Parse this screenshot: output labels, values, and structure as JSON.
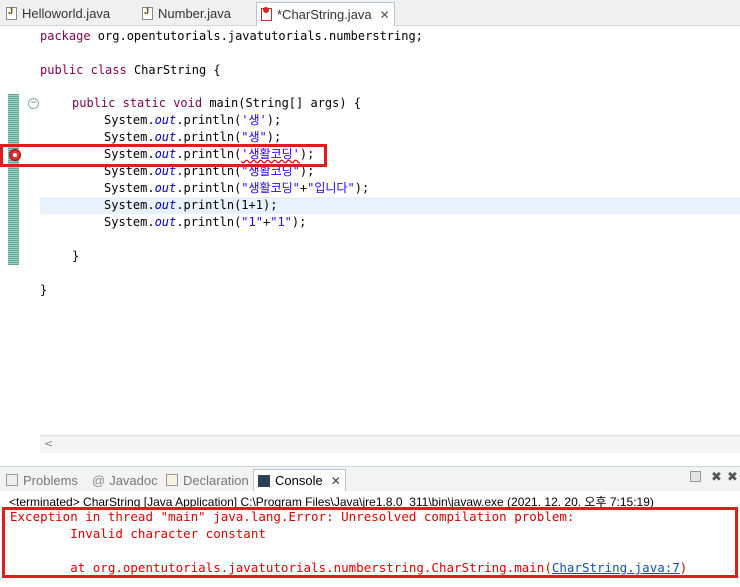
{
  "editor_tabs": [
    {
      "label": "Helloworld.java"
    },
    {
      "label": "Number.java"
    },
    {
      "label": "*CharString.java"
    }
  ],
  "code": {
    "line1": {
      "kw": "package",
      "rest": " org.opentutorials.javatutorials.numberstring;"
    },
    "line2": {
      "kw1": "public",
      "kw2": "class",
      "rest": " CharString {"
    },
    "main": {
      "kw1": "public",
      "kw2": "static",
      "kw3": "void",
      "rest": " main(String[] args) {"
    },
    "prefix": "System.",
    "out": "out",
    "println": ".println(",
    "end": ");",
    "s1": "'생'",
    "s2": "\"생\"",
    "s3": "'생활코딩'",
    "s4": "\"생활코딩\"",
    "s5a": "\"생활코딩\"",
    "s5b": "+",
    "s5c": "\"입니다\"",
    "n6": "1+1",
    "s7a": "\"1\"",
    "s7b": "+",
    "s7c": "\"1\"",
    "close_inner": "}",
    "close_outer": "}"
  },
  "panel_tabs": {
    "problems": "Problems",
    "javadoc": "Javadoc",
    "declaration": "Declaration",
    "console": "Console"
  },
  "console": {
    "terminated": "<terminated> CharString [Java Application] C:\\Program Files\\Java\\jre1.8.0_311\\bin\\javaw.exe (2021. 12. 20. 오후 7:15:19)",
    "err1": "Exception in thread \"main\" java.lang.Error: Unresolved compilation problem: ",
    "err2": "        Invalid character constant",
    "err3_prefix": "        at org.opentutorials.javatutorials.numberstring.CharString.main(",
    "err3_link": "CharString.java:7",
    "err3_suffix": ")"
  },
  "colors": {
    "highlight_box": "#e11c1c",
    "error_text": "#e00000",
    "keyword": "#7f0055",
    "string": "#2a00ff"
  },
  "icons": [
    "java-file-icon",
    "java-file-error-icon",
    "close-icon",
    "error-marker-icon",
    "fold-icon",
    "problems-icon",
    "javadoc-icon",
    "declaration-icon",
    "console-icon",
    "terminate-icon",
    "remove-launch-icon"
  ]
}
